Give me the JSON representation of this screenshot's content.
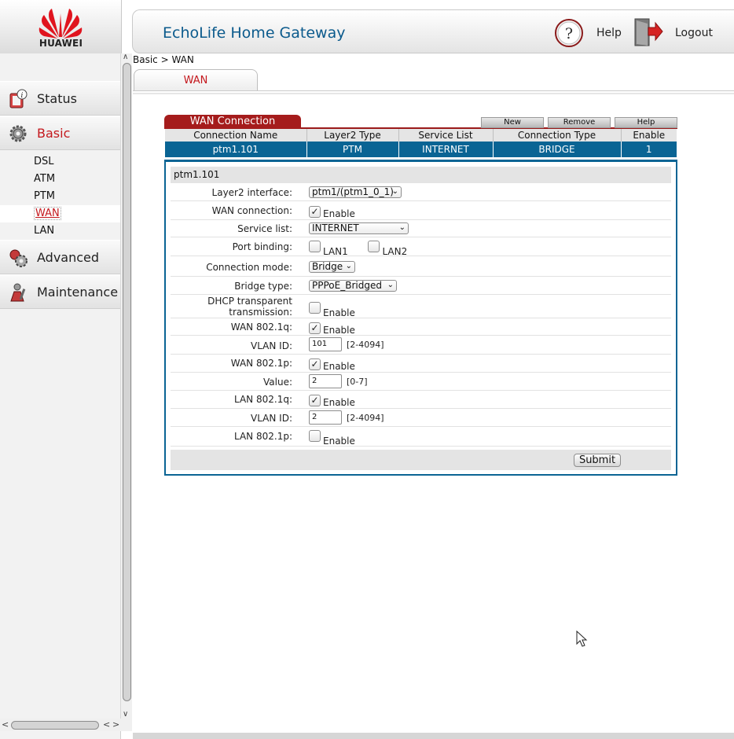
{
  "brand": {
    "logo_text": "HUAWEI"
  },
  "header": {
    "title": "EchoLife Home Gateway",
    "help_label": "Help",
    "logout_label": "Logout"
  },
  "sidebar": {
    "menu": [
      {
        "label": "Status",
        "icon": "status-icon",
        "active": false
      },
      {
        "label": "Basic",
        "icon": "gear-icon",
        "active": true
      },
      {
        "label": "Advanced",
        "icon": "advanced-icon",
        "active": false
      },
      {
        "label": "Maintenance",
        "icon": "maintenance-icon",
        "active": false
      }
    ],
    "basic_subitems": [
      "DSL",
      "ATM",
      "PTM",
      "WAN",
      "LAN"
    ],
    "active_subitem": "WAN"
  },
  "breadcrumb": "Basic > WAN",
  "tab": {
    "label": "WAN"
  },
  "wan_table": {
    "title": "WAN Connection",
    "buttons": {
      "new": "New",
      "remove": "Remove",
      "help": "Help"
    },
    "columns": [
      "Connection Name",
      "Layer2 Type",
      "Service List",
      "Connection Type",
      "Enable"
    ],
    "rows": [
      [
        "ptm1.101",
        "PTM",
        "INTERNET",
        "BRIDGE",
        "1"
      ]
    ]
  },
  "details": {
    "title": "ptm1.101",
    "layer2_interface": {
      "label": "Layer2 interface:",
      "value": "ptm1/(ptm1_0_1)"
    },
    "wan_connection": {
      "label": "WAN connection:",
      "checked": true,
      "option": "Enable"
    },
    "service_list": {
      "label": "Service list:",
      "value": "INTERNET"
    },
    "port_binding": {
      "label": "Port binding:",
      "lan1": "LAN1",
      "lan2": "LAN2"
    },
    "connection_mode": {
      "label": "Connection mode:",
      "value": "Bridge"
    },
    "bridge_type": {
      "label": "Bridge type:",
      "value": "PPPoE_Bridged"
    },
    "dhcp_transparent": {
      "label_line1": "DHCP transparent",
      "label_line2": "transmission:",
      "option": "Enable",
      "checked": false
    },
    "wan_8021q": {
      "label": "WAN 802.1q:",
      "option": "Enable",
      "checked": true
    },
    "wan_vlan_id": {
      "label": "VLAN ID:",
      "value": "101",
      "hint": "[2-4094]"
    },
    "wan_8021p": {
      "label": "WAN 802.1p:",
      "option": "Enable",
      "checked": true
    },
    "wan_value": {
      "label": "Value:",
      "value": "2",
      "hint": "[0-7]"
    },
    "lan_8021q": {
      "label": "LAN 802.1q:",
      "option": "Enable",
      "checked": true
    },
    "lan_vlan_id": {
      "label": "VLAN ID:",
      "value": "2",
      "hint": "[2-4094]"
    },
    "lan_8021p": {
      "label": "LAN 802.1p:",
      "option": "Enable",
      "checked": false
    },
    "submit_label": "Submit"
  },
  "colors": {
    "brand_red": "#c4181d",
    "table_blue": "#0a6494",
    "title_red": "#a51c1c"
  }
}
